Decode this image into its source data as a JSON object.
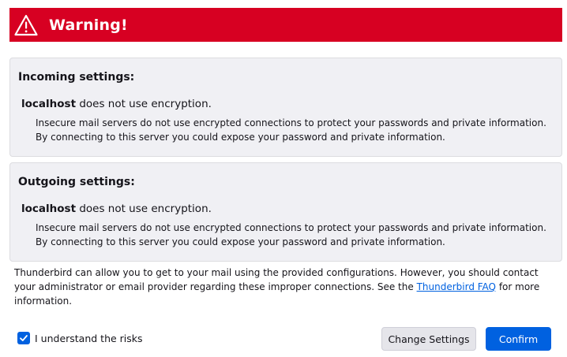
{
  "banner": {
    "title": "Warning!",
    "icon": "warning-triangle-icon",
    "color": "#d70022"
  },
  "incoming": {
    "heading": "Incoming settings:",
    "host": "localhost",
    "status": " does not use encryption.",
    "description": "Insecure mail servers do not use encrypted connections to protect your passwords and private information. By connecting to this server you could expose your password and private information."
  },
  "outgoing": {
    "heading": "Outgoing settings:",
    "host": "localhost",
    "status": " does not use encryption.",
    "description": "Insecure mail servers do not use encrypted connections to protect your passwords and private information. By connecting to this server you could expose your password and private information."
  },
  "footer": {
    "text_before": "Thunderbird can allow you to get to your mail using the provided configurations. However, you should contact your administrator or email provider regarding these improper connections. See the ",
    "link": "Thunderbird FAQ",
    "text_after": " for more information."
  },
  "understand": {
    "label": "I understand the risks",
    "checked": true
  },
  "buttons": {
    "change_settings": "Change Settings",
    "confirm": "Confirm"
  },
  "colors": {
    "accent": "#0061e0",
    "warning": "#d70022"
  }
}
